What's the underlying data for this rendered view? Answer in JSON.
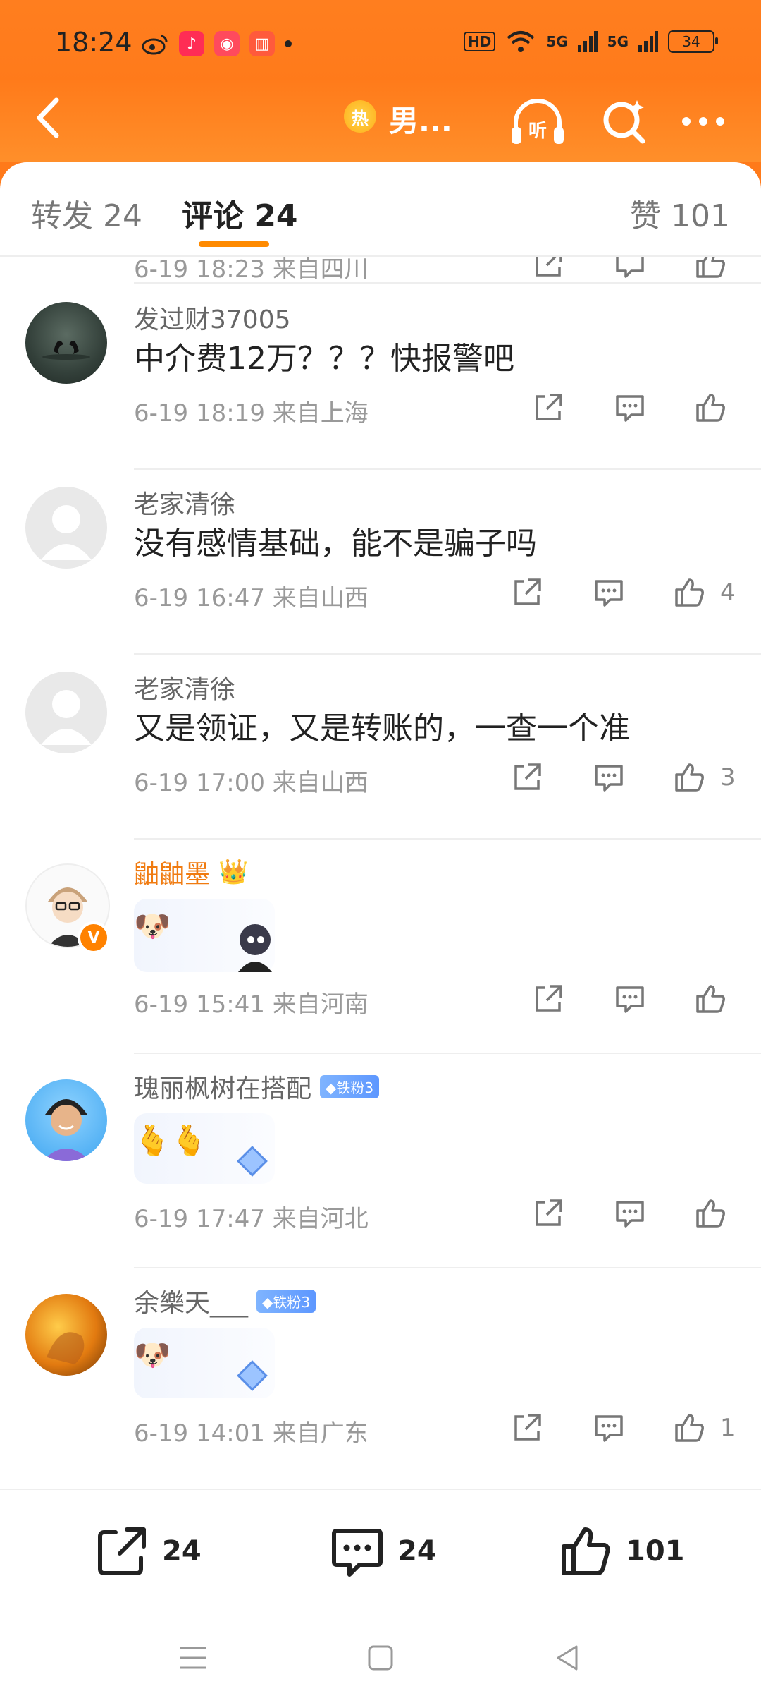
{
  "status_bar": {
    "time": "18:24",
    "hd": "HD",
    "net1": "5G",
    "net2": "5G",
    "battery": "34"
  },
  "header": {
    "hot_badge": "热",
    "title": "男..."
  },
  "tabs": {
    "repost": "转发 24",
    "comment": "评论 24",
    "like": "赞 101"
  },
  "clipped_row": {
    "time_loc": "6-19 18:23  来自四川"
  },
  "comments": [
    {
      "user": "发过财37005",
      "text": "中介费12万？？？快报警吧",
      "time": "6-19 18:19",
      "location": "来自上海",
      "likes": ""
    },
    {
      "user": "老家清徐",
      "text": "没有感情基础，能不是骗子吗",
      "time": "6-19 16:47",
      "location": "来自山西",
      "likes": "4"
    },
    {
      "user": "老家清徐",
      "text": "又是领证，又是转账的，一查一个准",
      "time": "6-19 17:00",
      "location": "来自山西",
      "likes": "3"
    },
    {
      "user": "鼬鼬墨",
      "emoji": "🐶",
      "time": "6-19 15:41",
      "location": "来自河南",
      "likes": ""
    },
    {
      "user": "瑰丽枫树在搭配",
      "fan_badge": "◆铁粉3",
      "emoji": "🫰🫰",
      "time": "6-19 17:47",
      "location": "来自河北",
      "likes": ""
    },
    {
      "user": "余樂天___",
      "fan_badge": "◆铁粉3",
      "emoji": "🐶",
      "time": "6-19 14:01",
      "location": "来自广东",
      "likes": "1"
    }
  ],
  "bottom_bar": {
    "reposts": "24",
    "comments": "24",
    "likes": "101"
  },
  "colors": {
    "accent": "#ff7a1a",
    "tab_underline": "#ff8a00",
    "vip_name": "#f07b10"
  }
}
